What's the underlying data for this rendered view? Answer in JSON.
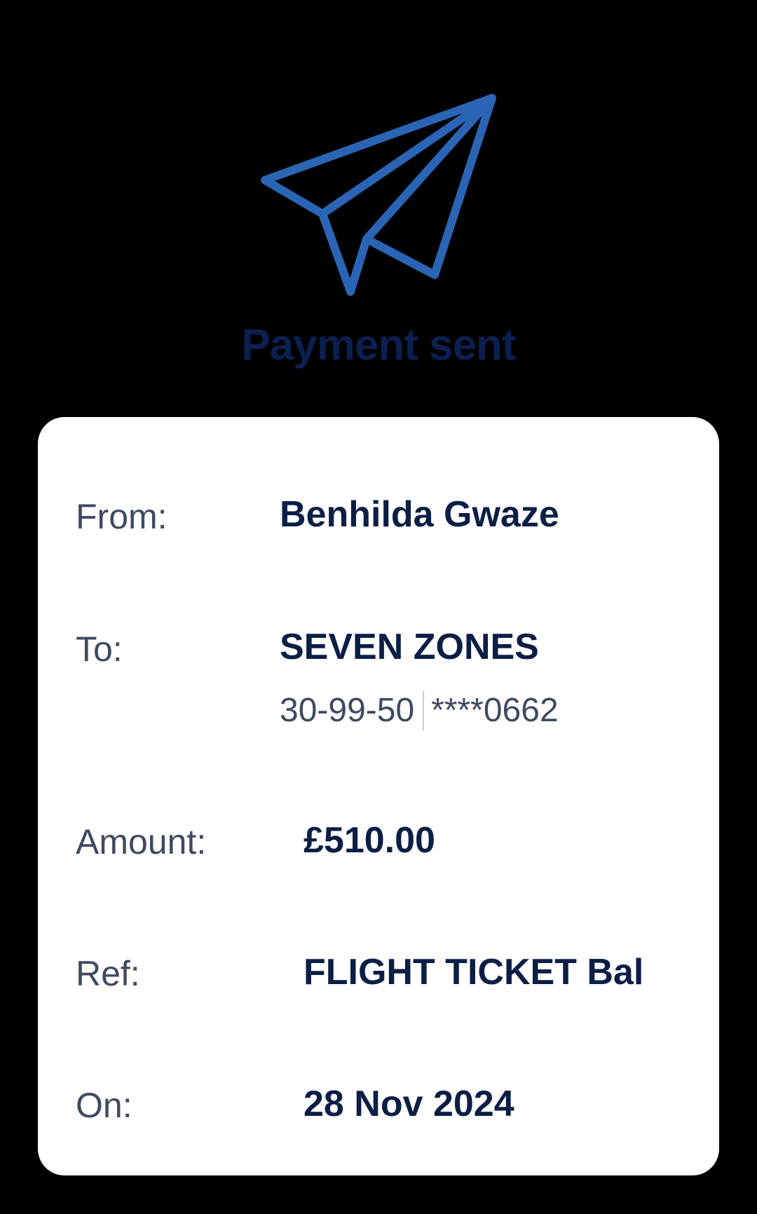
{
  "header": {
    "icon": "paper-plane-icon",
    "title": "Payment sent"
  },
  "colors": {
    "accent": "#2a64b4",
    "title": "#0b2050",
    "value_text": "#0b1e45",
    "label_text": "#3f4a61",
    "background": "#000000",
    "card": "#ffffff"
  },
  "details": {
    "from": {
      "label": "From:",
      "value": "Benhilda Gwaze"
    },
    "to": {
      "label": "To:",
      "value": "SEVEN ZONES",
      "sort_code": "30-99-50",
      "account": "****0662"
    },
    "amount": {
      "label": "Amount:",
      "value": "£510.00"
    },
    "ref": {
      "label": "Ref:",
      "value": "FLIGHT TICKET Bal"
    },
    "on": {
      "label": "On:",
      "value": "28 Nov 2024"
    }
  }
}
